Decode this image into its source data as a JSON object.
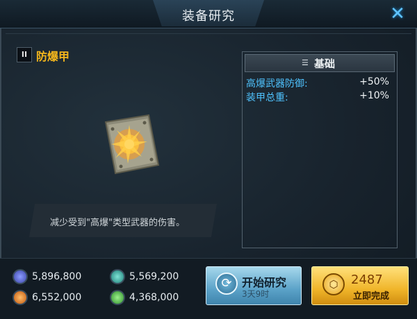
{
  "window": {
    "title": "装备研究"
  },
  "item": {
    "tier": "II",
    "name": "防爆甲",
    "description": "减少受到\"高爆\"类型武器的伤害。"
  },
  "stats": {
    "header": "基础",
    "rows": [
      {
        "label": "高爆武器防御:",
        "value": "+50%"
      },
      {
        "label": "装甲总重:",
        "value": "+10%"
      }
    ]
  },
  "resources": [
    {
      "icon": "radiation-icon",
      "value": "5,896,800",
      "color": "#5a6ad8"
    },
    {
      "icon": "layers-icon",
      "value": "5,569,200",
      "color": "#3fb6a8"
    },
    {
      "icon": "energy-icon",
      "value": "6,552,000",
      "color": "#f07c22"
    },
    {
      "icon": "crystal-icon",
      "value": "4,368,000",
      "color": "#48c04a"
    }
  ],
  "actions": {
    "start": {
      "label": "开始研究",
      "duration": "3天9时"
    },
    "instant": {
      "cost": "2487",
      "label": "立即完成"
    }
  },
  "icons": {
    "close": "close-icon",
    "clock": "clock-icon",
    "coin": "coin-icon",
    "list": "list-icon"
  }
}
